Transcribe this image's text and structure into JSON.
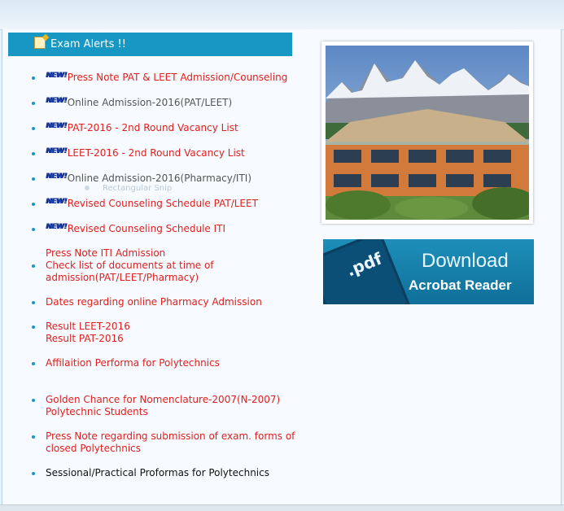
{
  "alerts": {
    "header_title": "Exam Alerts !!",
    "new_badge": "NEW!",
    "items": [
      {
        "lines": [
          "Press Note PAT & LEET Admission/Counseling"
        ],
        "new": true
      },
      {
        "lines": [
          "Online Admission-2016(PAT/LEET)"
        ],
        "new": true
      },
      {
        "lines": [
          "PAT-2016 - 2nd Round Vacancy List"
        ],
        "new": true
      },
      {
        "lines": [
          "LEET-2016 - 2nd Round Vacancy List"
        ],
        "new": true
      },
      {
        "lines": [
          "Online Admission-2016(Pharmacy/ITI)"
        ],
        "new": true
      },
      {
        "lines": [
          "Revised Counseling Schedule PAT/LEET"
        ],
        "new": true
      },
      {
        "lines": [
          "Revised Counseling Schedule ITI"
        ],
        "new": true
      },
      {
        "lines": [
          "Press Note ITI Admission",
          "Check list of documents at time of",
          "admission(PAT/LEET/Pharmacy)"
        ],
        "new": false
      },
      {
        "lines": [
          "Dates regarding online Pharmacy Admission"
        ],
        "new": false
      },
      {
        "lines": [
          "Result LEET-2016",
          "Result PAT-2016"
        ],
        "new": false
      },
      {
        "lines": [
          "Affilaition Performa for Polytechnics"
        ],
        "new": false
      },
      {
        "lines": [
          "Golden Chance for Nomenclature-2007(N-2007)",
          "Polytechnic Students"
        ],
        "new": false
      },
      {
        "lines": [
          "Press Note regarding submission of exam. forms of",
          "closed Polytechnics"
        ],
        "new": false
      },
      {
        "lines": [
          "Sessional/Practical Proformas for Polytechnics"
        ],
        "new": false
      }
    ]
  },
  "ghost_overlay": {
    "label": "Rectangular Snip"
  },
  "pdf_banner": {
    "doc_label": ".pdf",
    "title": "Download",
    "subtitle": "Acrobat Reader"
  },
  "colors": {
    "header_bg": "#1798c4",
    "link_red": "#e0201e",
    "link_grey": "#555555",
    "link_black": "#111111"
  }
}
